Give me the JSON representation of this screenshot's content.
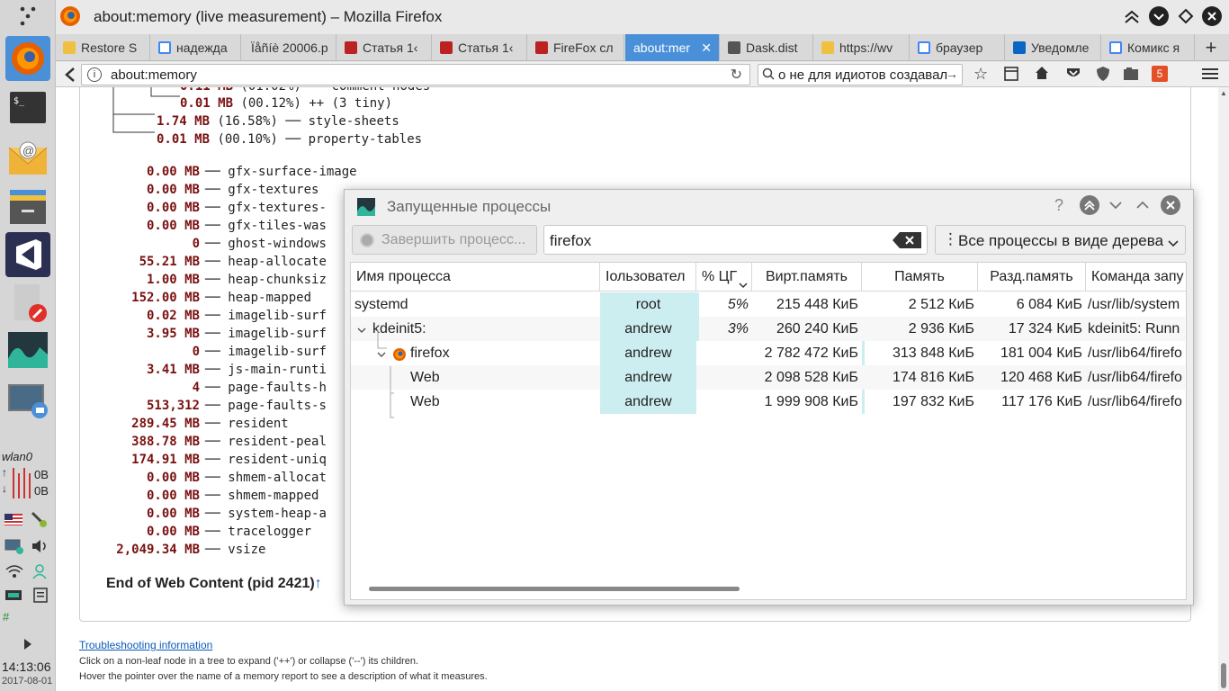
{
  "window": {
    "title": "about:memory (live measurement) – Mozilla Firefox"
  },
  "tabs": [
    {
      "label": "Restore S",
      "fav": "chat-icon"
    },
    {
      "label": "надежда",
      "fav": "google-icon"
    },
    {
      "label": "Ïåñíè 20006.р",
      "fav": "none"
    },
    {
      "label": "Статья 1‹",
      "fav": "page-icon"
    },
    {
      "label": "Статья 1‹",
      "fav": "page-icon"
    },
    {
      "label": "FireFox сл",
      "fav": "page-icon"
    },
    {
      "label": "about:mer",
      "fav": "none"
    },
    {
      "label": "Dask.dist",
      "fav": "table-icon"
    },
    {
      "label": "https://wv",
      "fav": "chat-icon"
    },
    {
      "label": "браузер",
      "fav": "google-icon"
    },
    {
      "label": "Уведомле",
      "fav": "linkedin-icon"
    },
    {
      "label": "Комикс я",
      "fav": "google-icon"
    }
  ],
  "nav": {
    "url": "about:memory",
    "search": "о не для идиотов создавал"
  },
  "tree_top": [
    {
      "value": "0.11 MB",
      "pct": "(01.02%)",
      "label": "── comment-nodes"
    },
    {
      "value": "0.01 MB",
      "pct": "(00.12%)",
      "label": "++ (3 tiny)"
    },
    {
      "value": "1.74 MB",
      "pct": "(16.58%)",
      "label": "── style-sheets"
    },
    {
      "value": "0.01 MB",
      "pct": "(00.10%)",
      "label": "── property-tables"
    }
  ],
  "reports": [
    {
      "value": "0.00 MB",
      "label": "gfx-surface-image"
    },
    {
      "value": "0.00 MB",
      "label": "gfx-textures"
    },
    {
      "value": "0.00 MB",
      "label": "gfx-textures-"
    },
    {
      "value": "0.00 MB",
      "label": "gfx-tiles-was"
    },
    {
      "value": "0",
      "label": "ghost-windows"
    },
    {
      "value": "55.21 MB",
      "label": "heap-allocate"
    },
    {
      "value": "1.00 MB",
      "label": "heap-chunksiz"
    },
    {
      "value": "152.00 MB",
      "label": "heap-mapped"
    },
    {
      "value": "0.02 MB",
      "label": "imagelib-surf"
    },
    {
      "value": "3.95 MB",
      "label": "imagelib-surf"
    },
    {
      "value": "0",
      "label": "imagelib-surf"
    },
    {
      "value": "3.41 MB",
      "label": "js-main-runti"
    },
    {
      "value": "4",
      "label": "page-faults-h"
    },
    {
      "value": "513,312",
      "label": "page-faults-s"
    },
    {
      "value": "289.45 MB",
      "label": "resident"
    },
    {
      "value": "388.78 MB",
      "label": "resident-peal"
    },
    {
      "value": "174.91 MB",
      "label": "resident-uniq"
    },
    {
      "value": "0.00 MB",
      "label": "shmem-allocat"
    },
    {
      "value": "0.00 MB",
      "label": "shmem-mapped"
    },
    {
      "value": "0.00 MB",
      "label": "system-heap-a"
    },
    {
      "value": "0.00 MB",
      "label": "tracelogger"
    },
    {
      "value": "2,049.34 MB",
      "label": "vsize"
    }
  ],
  "end_line": "End of Web Content (pid 2421)",
  "footer": {
    "link": "Troubleshooting information",
    "line1": "Click on a non-leaf node in a tree to expand ('++') or collapse ('--') its children.",
    "line2": "Hover the pointer over the name of a memory report to see a description of what it measures."
  },
  "panel": {
    "net_label": "wlan0",
    "net_up": "0B",
    "net_down": "0B",
    "time": "14:13:06",
    "date": "2017-08-01",
    "hash": "#"
  },
  "dialog": {
    "title": "Запущенные процессы",
    "kill_button": "Завершить процесс...",
    "search": "firefox",
    "view_select": "Все процессы в виде дерева",
    "columns": [
      "Имя процесса",
      "Іользовател",
      "% ЦГ",
      "Вирт.память",
      "Память",
      "Разд.память",
      "Команда запу"
    ],
    "rows": [
      {
        "name": "systemd",
        "user": "root",
        "cpu": "5%",
        "virt": "215 448 КиБ",
        "mem": "2 512 КиБ",
        "shared": "6 084 КиБ",
        "cmd": "/usr/lib/system"
      },
      {
        "name": "kdeinit5:",
        "user": "andrew",
        "cpu": "3%",
        "virt": "260 240 КиБ",
        "mem": "2 936 КиБ",
        "shared": "17 324 КиБ",
        "cmd": "kdeinit5: Runn"
      },
      {
        "name": "firefox",
        "user": "andrew",
        "cpu": "",
        "virt": "2 782 472 КиБ",
        "mem": "313 848 КиБ",
        "shared": "181 004 КиБ",
        "cmd": "/usr/lib64/firefo"
      },
      {
        "name": "Web",
        "user": "andrew",
        "cpu": "",
        "virt": "2 098 528 КиБ",
        "mem": "174 816 КиБ",
        "shared": "120 468 КиБ",
        "cmd": "/usr/lib64/firefo"
      },
      {
        "name": "Web",
        "user": "andrew",
        "cpu": "",
        "virt": "1 999 908 КиБ",
        "mem": "197 832 КиБ",
        "shared": "117 176 КиБ",
        "cmd": "/usr/lib64/firefo"
      }
    ]
  },
  "colors": {
    "accent": "#4a90d9",
    "value": "#7a1111",
    "user_cell": "#cdeef0",
    "link": "#0a5ab8"
  }
}
